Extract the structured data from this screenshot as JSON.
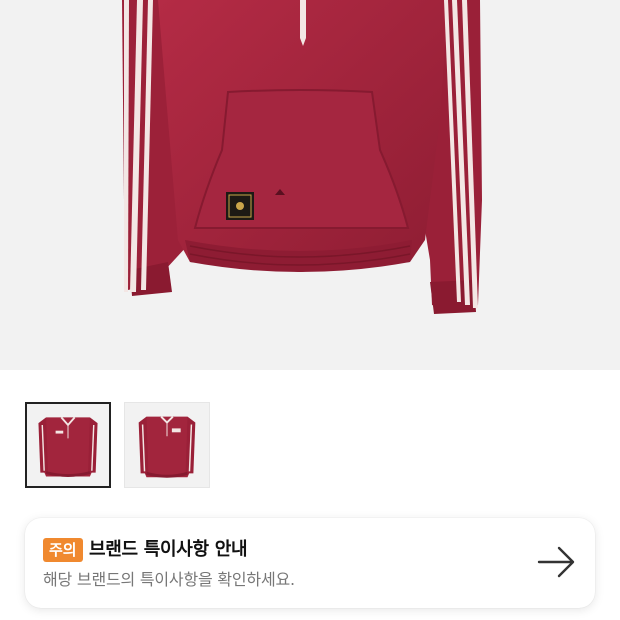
{
  "product": {
    "main_image": "red-track-jacket-product-image",
    "thumbnails": [
      {
        "image": "jacket-front-thumbnail",
        "selected": true
      },
      {
        "image": "jacket-alt-thumbnail",
        "selected": false
      }
    ]
  },
  "notice": {
    "badge": "주의",
    "title": "브랜드 특이사항 안내",
    "description": "해당 브랜드의 특이사항을 확인하세요.",
    "action_icon": "arrow-right-icon",
    "badge_color": "#f0892f"
  },
  "colors": {
    "jacket": "#a2253d",
    "stripe": "#f3e6e4",
    "image_background": "#f2f2f2"
  }
}
